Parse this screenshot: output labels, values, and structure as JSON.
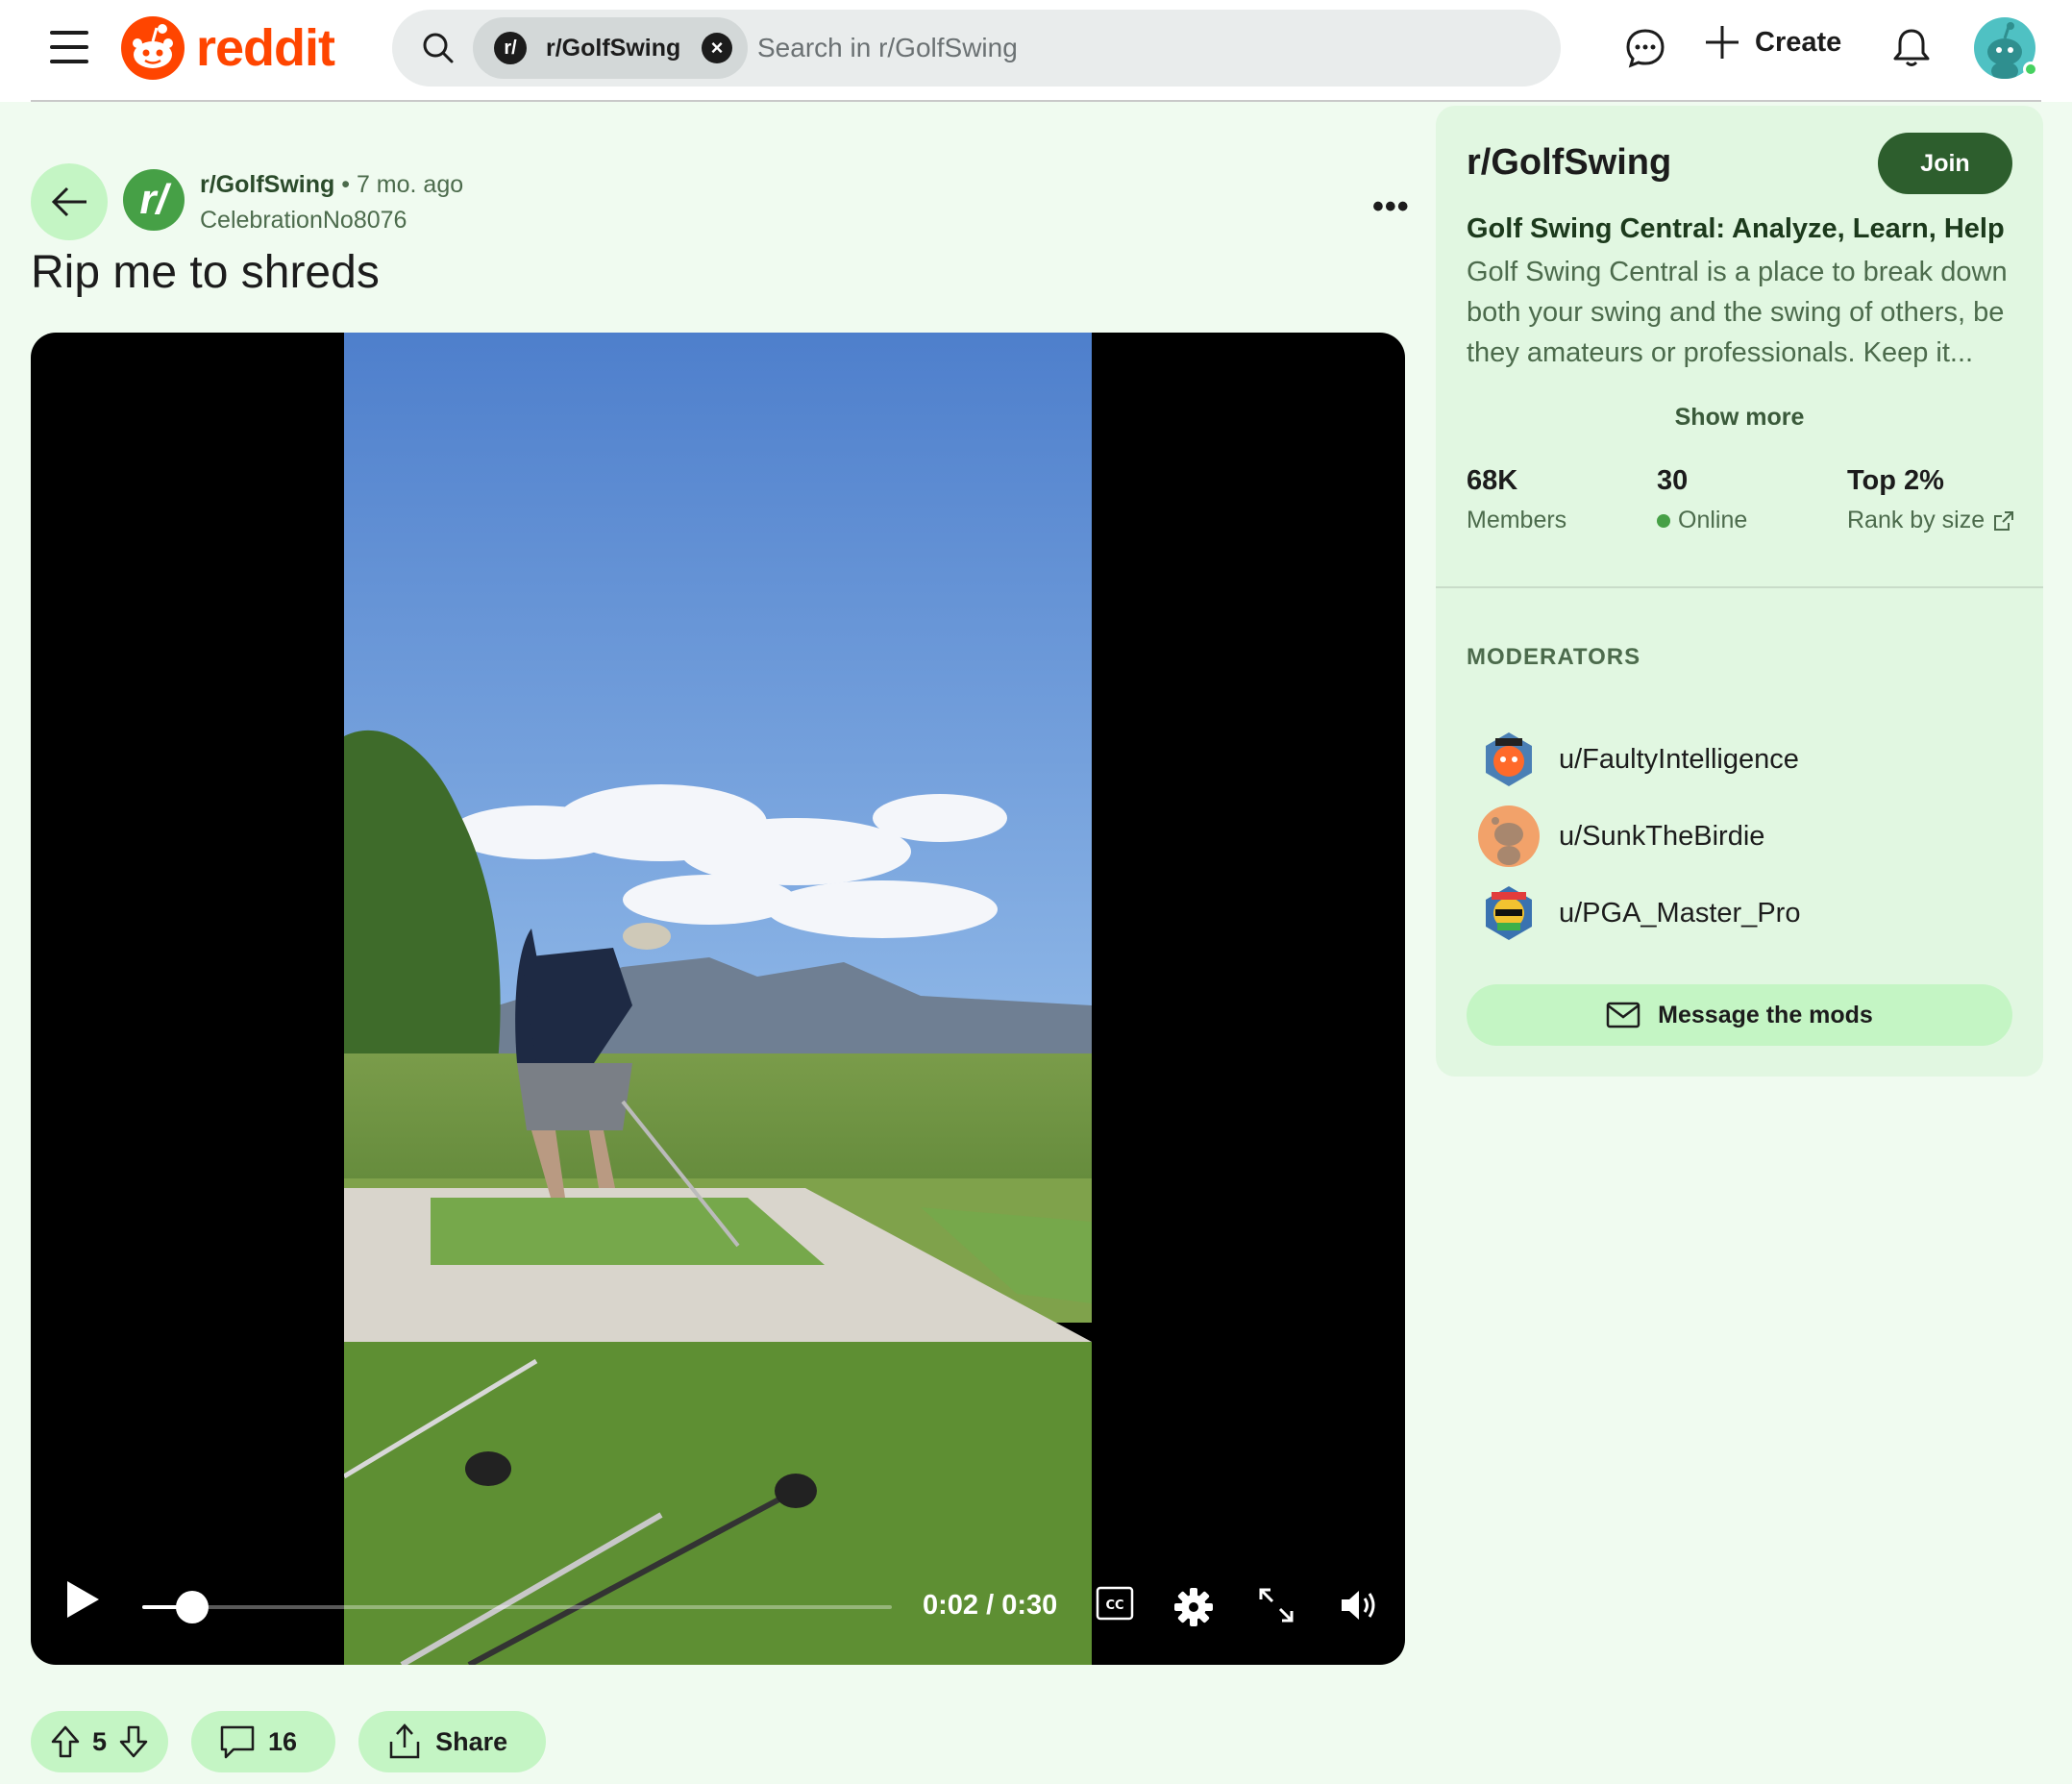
{
  "header": {
    "brand": "reddit",
    "search": {
      "scope_chip": "r/GolfSwing",
      "placeholder": "Search in r/GolfSwing"
    },
    "create_label": "Create"
  },
  "post": {
    "subreddit": "r/GolfSwing",
    "separator": "•",
    "age": "7 mo. ago",
    "author": "CelebrationNo8076",
    "title": "Rip me to shreds",
    "video": {
      "time_label": "0:02 / 0:30",
      "progress_fraction": 0.067
    },
    "votes": "5",
    "comments": "16",
    "share_label": "Share"
  },
  "sidebar": {
    "name": "r/GolfSwing",
    "join_label": "Join",
    "tagline": "Golf Swing Central: Analyze, Learn, Help",
    "description": "Golf Swing Central is a place to break down both your swing and the swing of others, be they amateurs or professionals. Keep it...",
    "show_more": "Show more",
    "stats": [
      {
        "value": "68K",
        "label": "Members"
      },
      {
        "value": "30",
        "label": "Online"
      },
      {
        "value": "Top 2%",
        "label": "Rank by size"
      }
    ],
    "moderators_heading": "MODERATORS",
    "moderators": [
      "u/FaultyIntelligence",
      "u/SunkTheBirdie",
      "u/PGA_Master_Pro"
    ],
    "message_mods": "Message the mods"
  },
  "colors": {
    "brand": "#ff4500",
    "page_bg": "#f0fbf0",
    "accent_light": "#c4f5c4",
    "accent_dark": "#2d5e2d",
    "sidebar_bg": "#e1f7e1"
  }
}
